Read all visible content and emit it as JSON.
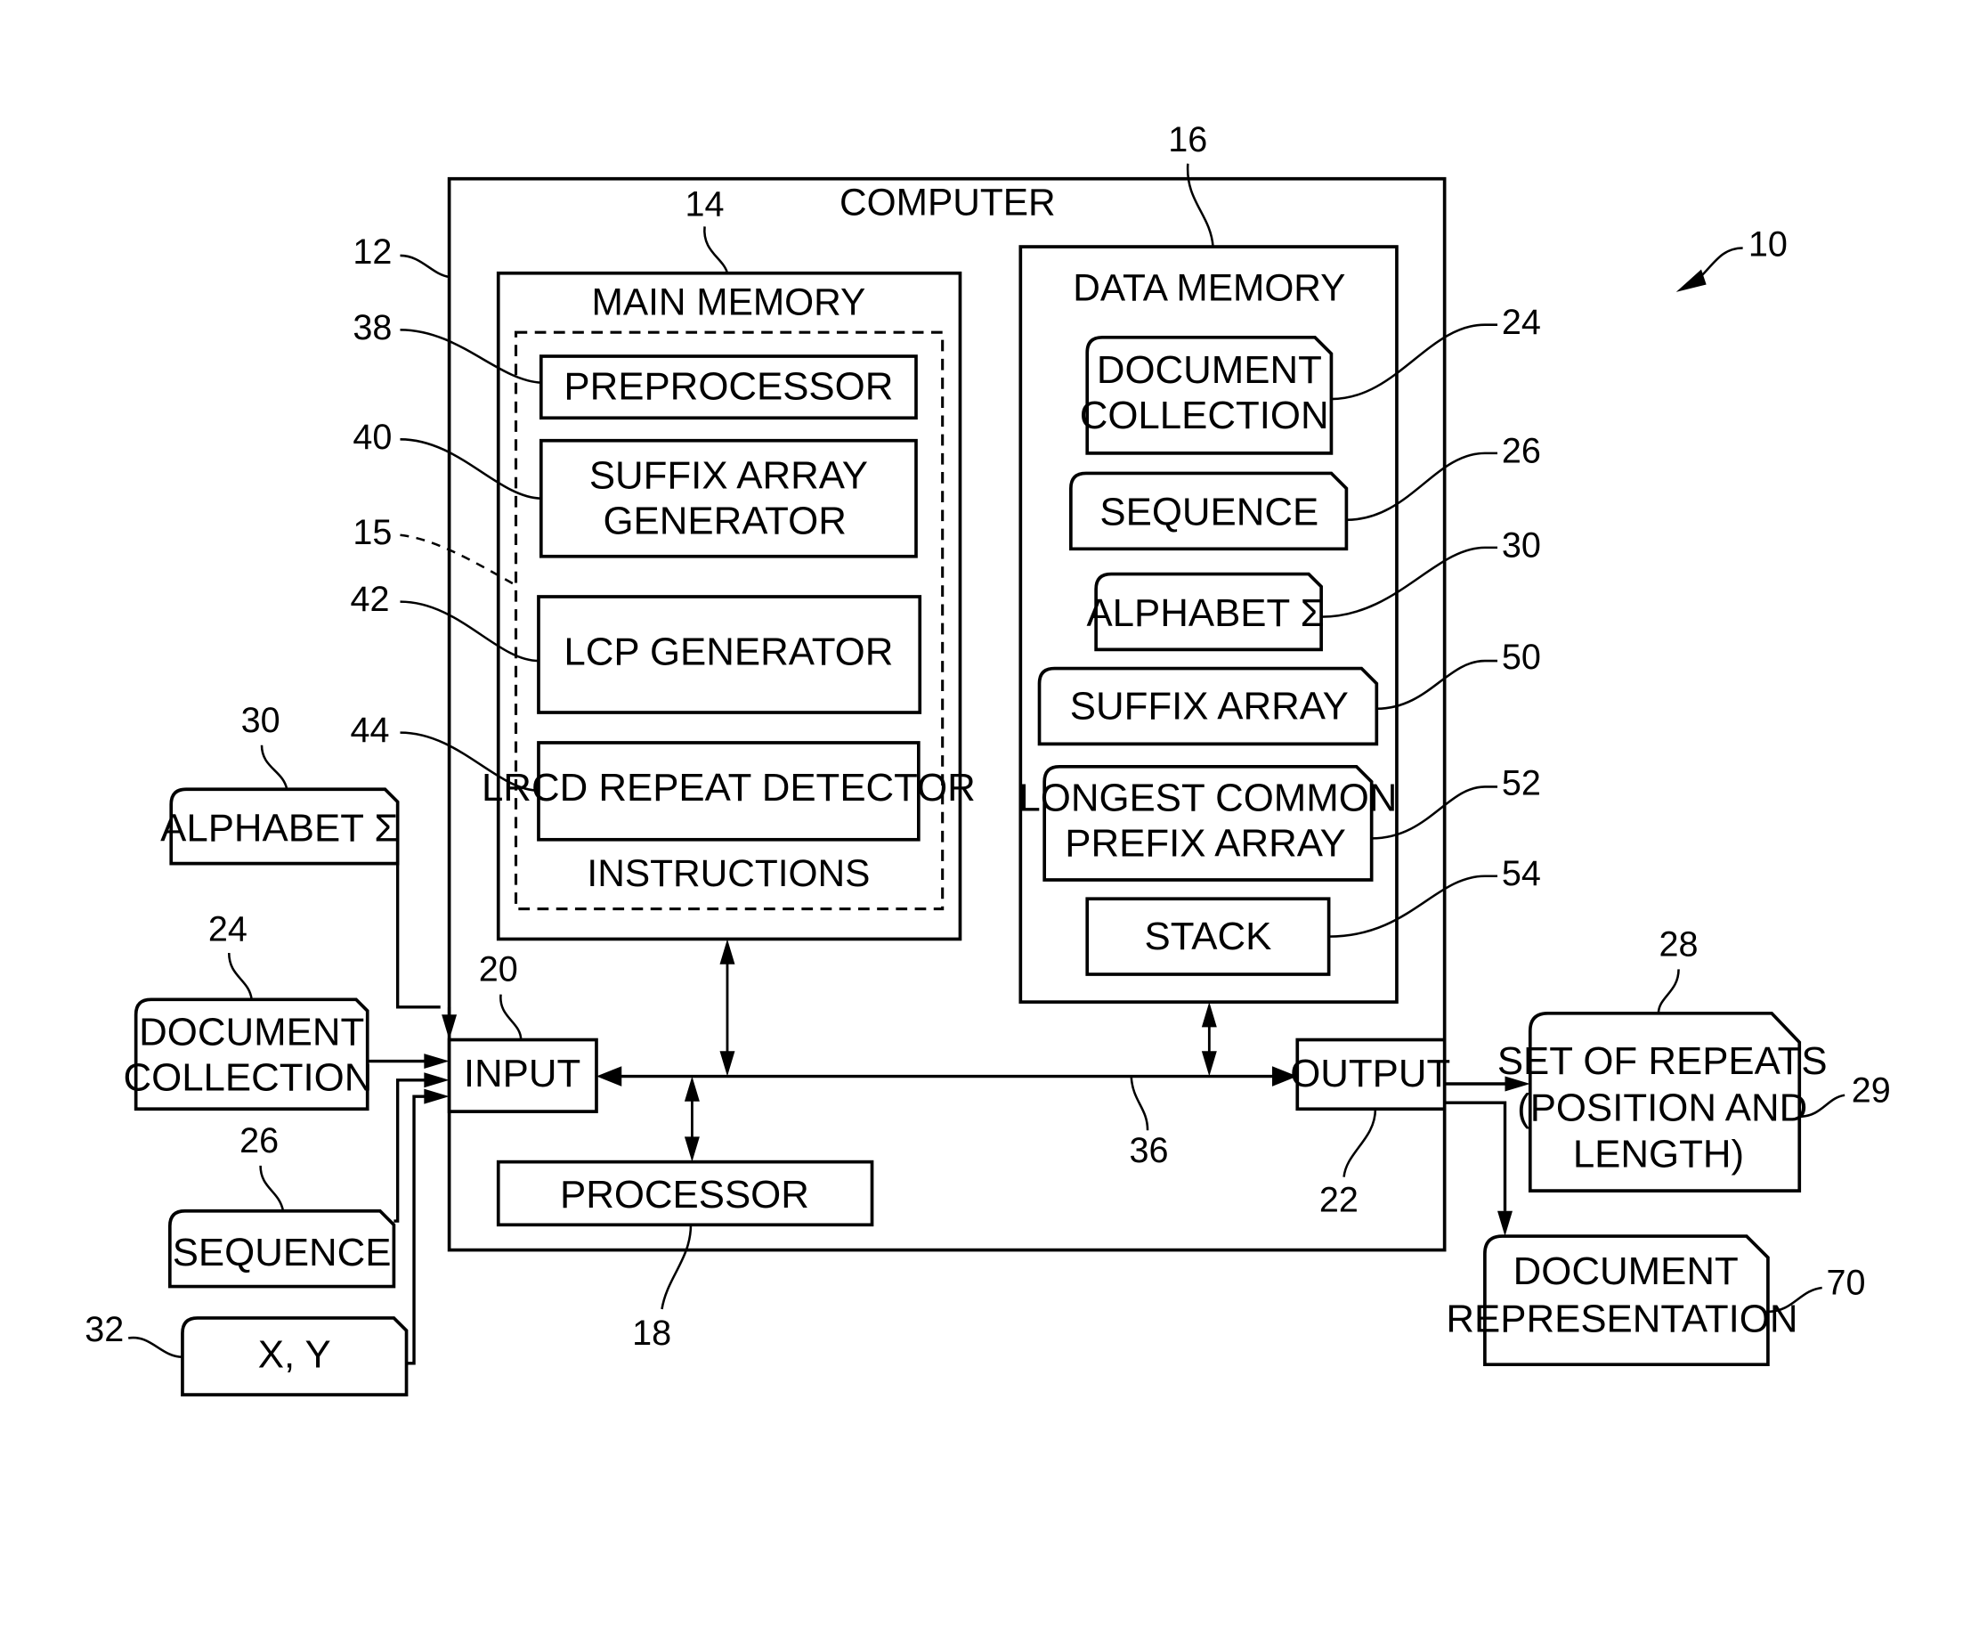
{
  "figure": {
    "ref": "10"
  },
  "computer": {
    "title": "COMPUTER",
    "ref": "12"
  },
  "main_memory": {
    "title": "MAIN MEMORY",
    "ref": "14",
    "instructions": {
      "title": "INSTRUCTIONS",
      "ref": "15",
      "modules": [
        {
          "lines": [
            "PREPROCESSOR"
          ],
          "ref": "38"
        },
        {
          "lines": [
            "SUFFIX ARRAY",
            "GENERATOR"
          ],
          "ref": "40"
        },
        {
          "lines": [
            "LCP GENERATOR"
          ],
          "ref": "42"
        },
        {
          "lines": [
            "LRCD REPEAT DETECTOR"
          ],
          "ref": "44"
        }
      ]
    }
  },
  "data_memory": {
    "title": "DATA MEMORY",
    "ref": "16",
    "items": [
      {
        "lines": [
          "DOCUMENT",
          "COLLECTION"
        ],
        "ref": "24",
        "shape": "document"
      },
      {
        "lines": [
          "SEQUENCE"
        ],
        "ref": "26",
        "shape": "document"
      },
      {
        "lines": [
          "ALPHABET Σ"
        ],
        "ref": "30",
        "shape": "document"
      },
      {
        "lines": [
          "SUFFIX ARRAY"
        ],
        "ref": "50",
        "shape": "document"
      },
      {
        "lines": [
          "LONGEST COMMON",
          "PREFIX ARRAY"
        ],
        "ref": "52",
        "shape": "document"
      },
      {
        "lines": [
          "STACK"
        ],
        "ref": "54",
        "shape": "rectangle"
      }
    ]
  },
  "processor": {
    "label": "PROCESSOR",
    "ref": "18"
  },
  "input": {
    "label": "INPUT",
    "ref": "20"
  },
  "output": {
    "label": "OUTPUT",
    "ref": "22"
  },
  "bus": {
    "ref": "36"
  },
  "external_inputs": [
    {
      "lines": [
        "ALPHABET Σ"
      ],
      "ref": "30"
    },
    {
      "lines": [
        "DOCUMENT",
        "COLLECTION"
      ],
      "ref": "24"
    },
    {
      "lines": [
        "SEQUENCE"
      ],
      "ref": "26"
    },
    {
      "lines": [
        "X, Y"
      ],
      "ref": "32"
    }
  ],
  "external_outputs": [
    {
      "lines": [
        "SET OF REPEATS",
        "(POSITION AND",
        "LENGTH)"
      ],
      "ref": "28",
      "ref2": "29"
    },
    {
      "lines": [
        "DOCUMENT",
        "REPRESENTATION"
      ],
      "ref": "70"
    }
  ]
}
